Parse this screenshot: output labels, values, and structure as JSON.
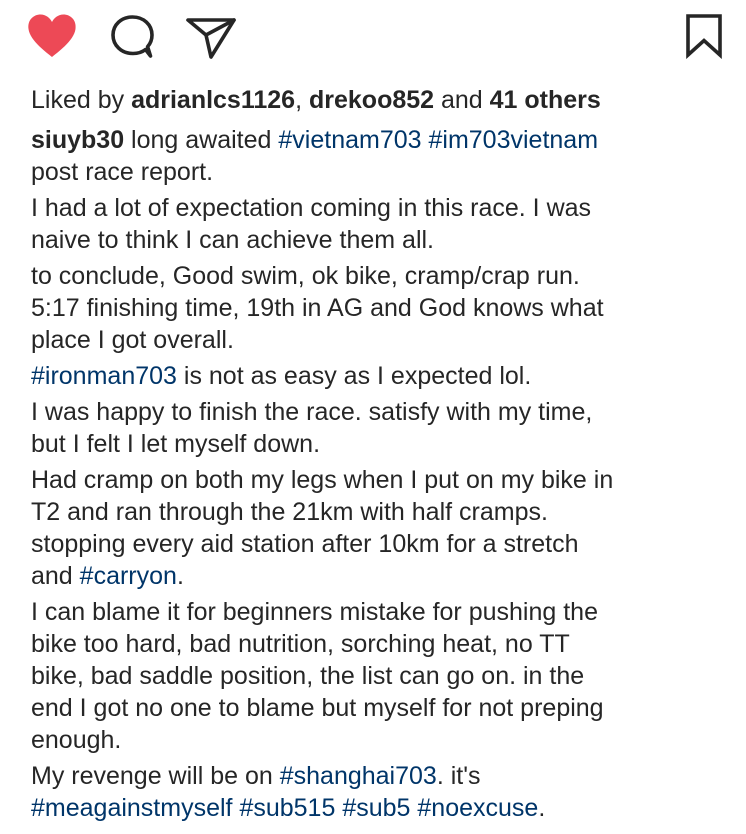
{
  "actions": {
    "like_icon": "heart-icon",
    "comment_icon": "comment-bubble-icon",
    "share_icon": "paper-plane-icon",
    "save_icon": "bookmark-icon",
    "like_color": "#ed4956"
  },
  "likes": {
    "prefix": "Liked by ",
    "user1": "adrianlcs1126",
    "separator": ", ",
    "user2": "drekoo852",
    "and": " and ",
    "others": "41 others"
  },
  "caption": {
    "username": "siuyb30",
    "p1": {
      "l1_text": " long awaited ",
      "l1_tag1": "#vietnam703",
      "l1_space": " ",
      "l1_tag2": "#im703vietnam",
      "l2": "post race report."
    },
    "p2": {
      "l1": "I had a lot of expectation coming in this race. I was",
      "l2": "naive to think I can achieve them all."
    },
    "p3": {
      "l1": "to conclude, Good swim, ok bike, cramp/crap run.",
      "l2": "5:17 finishing time, 19th in AG and God knows what",
      "l3": "place I got overall."
    },
    "p4": {
      "tag": "#ironman703",
      "text": " is not as easy as I expected lol."
    },
    "p5": {
      "l1": "I was happy to finish the race. satisfy with my time,",
      "l2": "but I felt I let myself down."
    },
    "p6": {
      "l1": "Had cramp on both my legs when I put on my bike in",
      "l2": "T2 and ran through the 21km with half cramps.",
      "l3": "stopping every aid station after 10km for a stretch",
      "l4_text": "and ",
      "l4_tag": "#carryon",
      "l4_end": "."
    },
    "p7": {
      "l1": "I can blame it for beginners mistake for pushing the",
      "l2": "bike too hard, bad nutrition, sorching heat, no TT",
      "l3": "bike, bad saddle position, the list can go on. in the",
      "l4": "end I got no one to blame but myself for not preping",
      "l5": "enough."
    },
    "p8": {
      "l1_text": "My revenge will be on ",
      "l1_tag": "#shanghai703",
      "l1_end": ". it's",
      "l2_tag1": "#meagainstmyself",
      "l2_tag2": "#sub515",
      "l2_tag3": "#sub5",
      "l2_tag4": "#noexcuse",
      "l2_space": " ",
      "l2_end": "."
    }
  }
}
